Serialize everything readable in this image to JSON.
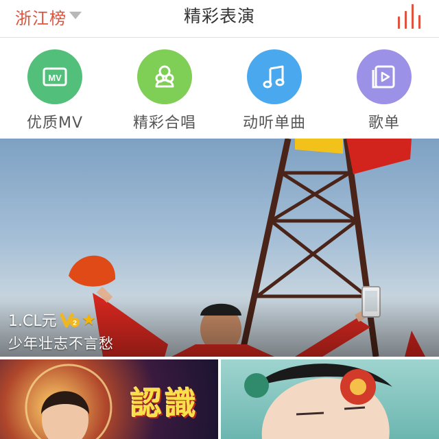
{
  "header": {
    "region_label": "浙江榜",
    "title": "精彩表演"
  },
  "categories": [
    {
      "label": "优质MV",
      "color": "#52c07a",
      "icon": "mv-icon"
    },
    {
      "label": "精彩合唱",
      "color": "#7fce55",
      "icon": "chorus-icon"
    },
    {
      "label": "动听单曲",
      "color": "#4aa8ee",
      "icon": "music-note-icon"
    },
    {
      "label": "歌单",
      "color": "#9b91e6",
      "icon": "playlist-icon"
    }
  ],
  "featured": {
    "user_name": "1.CL元",
    "song_title": "少年壮志不言愁"
  },
  "thumbnails": [
    {
      "overlay_text": "認識"
    },
    {
      "overlay_text": ""
    }
  ],
  "colors": {
    "accent": "#e0533e"
  }
}
